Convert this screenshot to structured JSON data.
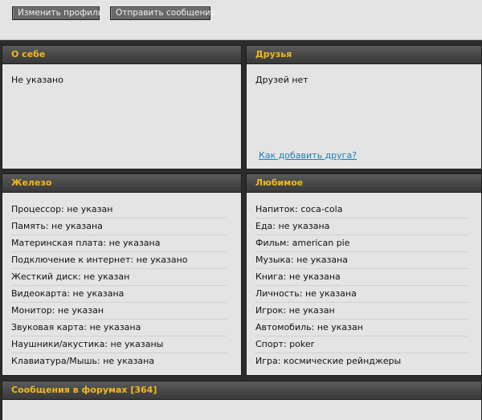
{
  "toolbar": {
    "edit_profile_label": "Изменить профиль",
    "send_message_label": "Отправить сообщение"
  },
  "about": {
    "title": "О себе",
    "text": "Не указано"
  },
  "friends": {
    "title": "Друзья",
    "text": "Друзей нет",
    "add_link": "Как добавить друга?"
  },
  "hardware": {
    "title": "Железо",
    "items": [
      "Процессор: не указан",
      "Память: не указана",
      "Материнская плата: не указана",
      "Подключение к интернет: не указано",
      "Жесткий диск: не указан",
      "Видеокарта: не указана",
      "Монитор: не указан",
      "Звуковая карта: не указана",
      "Наушники/акустика: не указаны",
      "Клавиатура/Мышь: не указана"
    ]
  },
  "favorites": {
    "title": "Любимое",
    "items": [
      "Напиток: coca-cola",
      "Еда: не указана",
      "Фильм: american pie",
      "Музыка: не указана",
      "Книга: не указана",
      "Личность: не указана",
      "Игрок: не указан",
      "Автомобиль: не указан",
      "Спорт: poker",
      "Игра: космические рейнджеры"
    ]
  },
  "forum_posts": {
    "title": "Сообщения в форумах [364]"
  },
  "colors": {
    "header_text": "#f2b81c",
    "panel_bg": "#e4e4e4",
    "page_bg": "#2c2c2c",
    "link": "#1a7fb5"
  }
}
